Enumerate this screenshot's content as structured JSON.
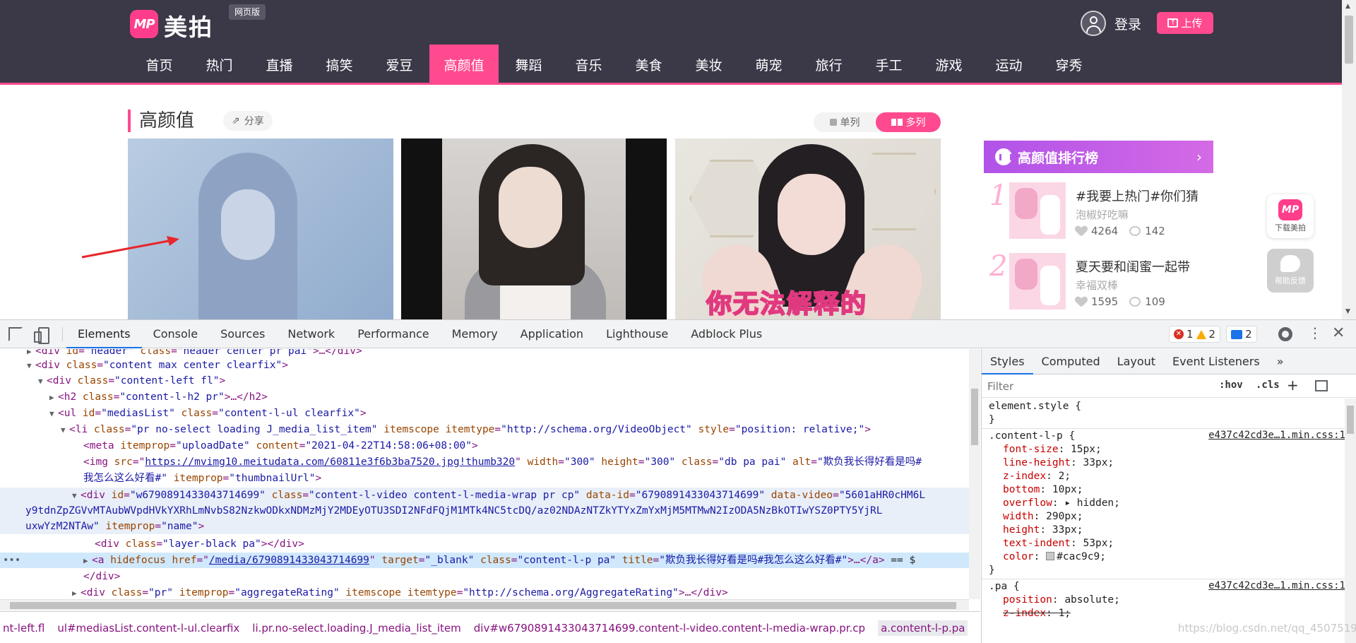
{
  "site": {
    "logo_text": "MP",
    "brand": "美拍",
    "web_version_badge": "网页版",
    "login": "登录",
    "upload": "上传",
    "nav": [
      "首页",
      "热门",
      "直播",
      "搞笑",
      "爱豆",
      "高颜值",
      "舞蹈",
      "音乐",
      "美食",
      "美妆",
      "萌宠",
      "旅行",
      "手工",
      "游戏",
      "运动",
      "穿秀"
    ],
    "nav_active": "高颜值",
    "section_title": "高颜值",
    "share": "分享",
    "view_single": "单列",
    "view_multi": "多列",
    "video_caption_3": "你无法解释的",
    "ranking": {
      "title": "高颜值排行榜",
      "items": [
        {
          "rank": "1",
          "title": "#我要上热门#你们猜",
          "author": "泡椒好吃嘛",
          "likes": "4264",
          "comments": "142"
        },
        {
          "rank": "2",
          "title": "夏天要和闺蜜一起带",
          "author": "幸福双棒",
          "likes": "1595",
          "comments": "109"
        }
      ]
    },
    "float_download": "下载美拍",
    "float_help": "帮助反馈",
    "colors": {
      "accent": "#ff4a8f",
      "header_bg": "#3b3848",
      "ranking": "#c25ee8"
    }
  },
  "devtools": {
    "tabs": [
      "Elements",
      "Console",
      "Sources",
      "Network",
      "Performance",
      "Memory",
      "Application",
      "Lighthouse",
      "Adblock Plus"
    ],
    "active_tab": "Elements",
    "errors": "1",
    "warnings": "2",
    "issues": "2",
    "dom": {
      "l1": {
        "tag": "<div ",
        "a1": "id",
        "v1": "\"header\"",
        "a2": "class",
        "v2": "\"header center pr pai\"",
        "end": ">…</div>"
      },
      "l2": {
        "tag": "<div ",
        "a1": "class",
        "v1": "\"content max center clearfix\"",
        "end": ">"
      },
      "l3": {
        "tag": "<div ",
        "a1": "class",
        "v1": "\"content-left fl\"",
        "end": ">"
      },
      "l4": {
        "tag": "<h2 ",
        "a1": "class",
        "v1": "\"content-l-h2 pr\"",
        "end": ">…</h2>"
      },
      "l5": {
        "tag": "<ul ",
        "a1": "id",
        "v1": "\"mediasList\"",
        "a2": "class",
        "v2": "\"content-l-ul clearfix\"",
        "end": ">"
      },
      "l6": {
        "tag": "<li ",
        "a1": "class",
        "v1": "\"pr no-select loading  J_media_list_item\"",
        "a2": "itemscope",
        "a3": "itemtype",
        "v3": "\"http://schema.org/VideoObject\"",
        "a4": "style",
        "v4": "\"position: relative;\"",
        "end": ">"
      },
      "l7": {
        "tag": "<meta ",
        "a1": "itemprop",
        "v1": "\"uploadDate\"",
        "a2": "content",
        "v2": "\"2021-04-22T14:58:06+08:00\"",
        "end": ">"
      },
      "l8": {
        "tag": "<img ",
        "a1": "src",
        "v1": "https://mvimg10.meitudata.com/60811e3f6b3ba7520.jpg!thumb320",
        "a2": "width",
        "v2": "\"300\"",
        "a3": "height",
        "v3": "\"300\"",
        "a4": "class",
        "v4": "\"db pa pai\"",
        "a5": "alt",
        "v5": "\"欺负我长得好看是吗#"
      },
      "l9": {
        "v": "我怎么这么好看#\"",
        "a1": "itemprop",
        "v1": "\"thumbnailUrl\"",
        "end": ">"
      },
      "l10": {
        "tag": "<div ",
        "a1": "id",
        "v1": "\"w6790891433043714699\"",
        "a2": "class",
        "v2": "\"content-l-video content-l-media-wrap pr cp\"",
        "a3": "data-id",
        "v3": "\"6790891433043714699\"",
        "a4": "data-video",
        "v4": "\"5601aHR0cHM6L"
      },
      "l11": {
        "v": "y9tdnZpZGVvMTAubWVpdHVkYXRhLmNvbS82NzkwODkxNDMzMjY2MDEyOTU3SDI2NFdFQjM1MTk4NC5tcDQ/az02NDAzNTZkYTYxZmYxMjM5MTMwN2IzODA5NzBkOTIwYSZ0PTY5YjRL"
      },
      "l12": {
        "v": "uxwYzM2NTAw\"",
        "a1": "itemprop",
        "v1": "\"name\"",
        "end": ">"
      },
      "l13": {
        "tag": "<div ",
        "a1": "class",
        "v1": "\"layer-black pa\"",
        "end": "></div>"
      },
      "l14": {
        "tag": "<a ",
        "a0": "hidefocus ",
        "a1": "href",
        "v1": "/media/6790891433043714699",
        "a2": "target",
        "v2": "\"_blank\"",
        "a3": "class",
        "v3": "\"content-l-p pa\"",
        "a4": "title",
        "v4": "\"欺负我长得好看是吗#我怎么这么好看#\"",
        "end": ">…</a>",
        "eq": " == $"
      },
      "l15": {
        "end": "</div>"
      },
      "l16": {
        "tag": "<div ",
        "a1": "class",
        "v1": "\"pr\"",
        "a2": "itemprop",
        "v2": "\"aggregateRating\"",
        "a3": "itemscope ",
        "a4": "itemtype",
        "v4": "\"http://schema.org/AggregateRating\"",
        "end": ">…</div>"
      }
    },
    "breadcrumbs": [
      "nt-left.fl",
      "ul#mediasList.content-l-ul.clearfix",
      "li.pr.no-select.loading.J_media_list_item",
      "div#w6790891433043714699.content-l-video.content-l-media-wrap.pr.cp",
      "a.content-l-p.pa",
      "…"
    ],
    "styles": {
      "tabs": [
        "Styles",
        "Computed",
        "Layout",
        "Event Listeners",
        "»"
      ],
      "active_tab": "Styles",
      "filter_placeholder": "Filter",
      "hov": ":hov",
      "cls": ".cls",
      "element_style": "element.style {",
      "close_brace": "}",
      "rule1_selector": ".content-l-p {",
      "rule1_source": "e437c42cd3e…1.min.css:1",
      "rule1": [
        {
          "p": "font-size",
          "v": "15px;"
        },
        {
          "p": "line-height",
          "v": "33px;"
        },
        {
          "p": "z-index",
          "v": "2;"
        },
        {
          "p": "bottom",
          "v": "10px;"
        },
        {
          "p": "overflow",
          "v": "▸ hidden;"
        },
        {
          "p": "width",
          "v": "290px;"
        },
        {
          "p": "height",
          "v": "33px;"
        },
        {
          "p": "text-indent",
          "v": "53px;"
        },
        {
          "p": "color",
          "v": "#cac9c9;"
        }
      ],
      "rule2_selector": ".pa {",
      "rule2_source": "e437c42cd3e…1.min.css:1",
      "rule2": [
        {
          "p": "position",
          "v": "absolute;"
        },
        {
          "p": "z-index",
          "v": "1;"
        }
      ]
    },
    "watermark": "https://blog.csdn.net/qq_4507519"
  }
}
